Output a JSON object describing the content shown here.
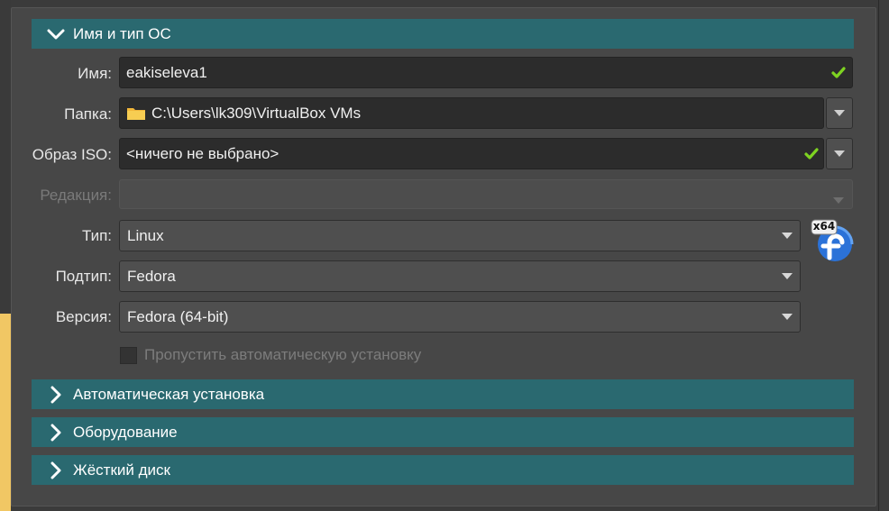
{
  "sections": {
    "name_os": {
      "title": "Имя и тип ОС",
      "expanded": true
    },
    "unattended": {
      "title": "Автоматическая установка",
      "expanded": false
    },
    "hardware": {
      "title": "Оборудование",
      "expanded": false
    },
    "hard_disk": {
      "title": "Жёсткий диск",
      "expanded": false
    }
  },
  "form": {
    "name": {
      "label": "Имя:",
      "value": "eakiseleva1",
      "valid": true
    },
    "folder": {
      "label": "Папка:",
      "value": "C:\\Users\\lk309\\VirtualBox VMs"
    },
    "iso": {
      "label": "Образ ISO:",
      "value": "<ничего не выбрано>",
      "valid": true
    },
    "edition": {
      "label": "Редакция:",
      "value": "",
      "enabled": false
    },
    "type": {
      "label": "Тип:",
      "value": "Linux"
    },
    "subtype": {
      "label": "Подтип:",
      "value": "Fedora"
    },
    "version": {
      "label": "Версия:",
      "value": "Fedora (64-bit)"
    },
    "skip_unattended": {
      "label": "Пропустить автоматическую установку",
      "checked": false,
      "enabled": false
    }
  },
  "os_icon": {
    "name": "fedora-x64-icon",
    "badge": "x64"
  },
  "colors": {
    "section_header": "#2a6970",
    "valid_check": "#7ed321",
    "fedora_blue": "#2b72d8"
  }
}
